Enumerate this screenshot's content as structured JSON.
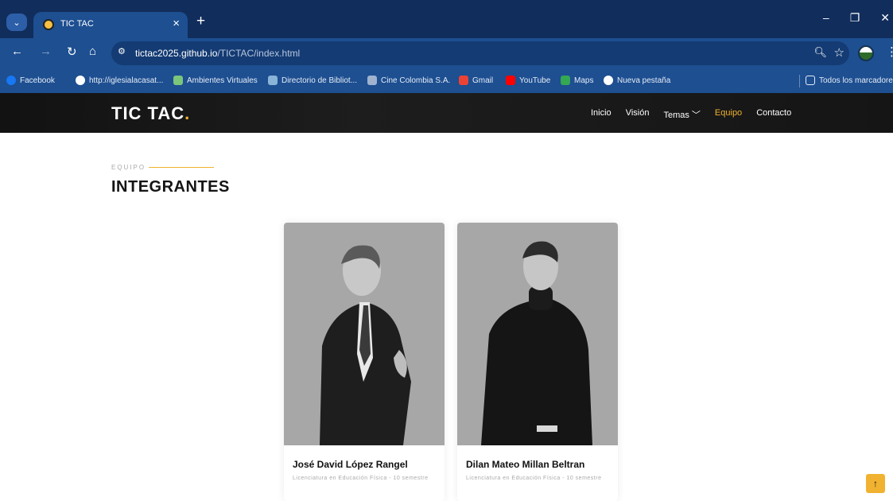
{
  "browser": {
    "tab_title": "TIC TAC",
    "url_host": "tictac2025.github.io",
    "url_path": "/TICTAC/index.html",
    "bookmarks": [
      {
        "label": "Facebook",
        "color": "#1877f2"
      },
      {
        "label": "http://iglesialacasat...",
        "color": "#ffffff"
      },
      {
        "label": "Ambientes Virtuales",
        "color": "#7bc67b"
      },
      {
        "label": "Directorio de Bibliot...",
        "color": "#8ab4d8"
      },
      {
        "label": "Cine Colombia S.A.",
        "color": "#9fb3cf"
      },
      {
        "label": "Gmail",
        "color": "#ea4335"
      },
      {
        "label": "YouTube",
        "color": "#ff0000"
      },
      {
        "label": "Maps",
        "color": "#34a853"
      },
      {
        "label": "Nueva pestaña",
        "color": "#ffffff"
      }
    ],
    "all_bookmarks": "Todos los marcadores"
  },
  "site": {
    "logo": "TIC TAC",
    "logo_dot": ".",
    "menu": [
      "Inicio",
      "Visión",
      "Temas ﹀",
      "Equipo",
      "Contacto"
    ],
    "active_menu": "Equipo",
    "accent": "#f0b230"
  },
  "section": {
    "kicker": "EQUIPO",
    "title": "INTEGRANTES"
  },
  "members": [
    {
      "name": "José David López Rangel",
      "role": "Licenciatura en Educación Física - 10 semestre"
    },
    {
      "name": "Dilan Mateo Millan Beltran",
      "role": "Licenciatura en Educación Física - 10 semestre"
    }
  ]
}
